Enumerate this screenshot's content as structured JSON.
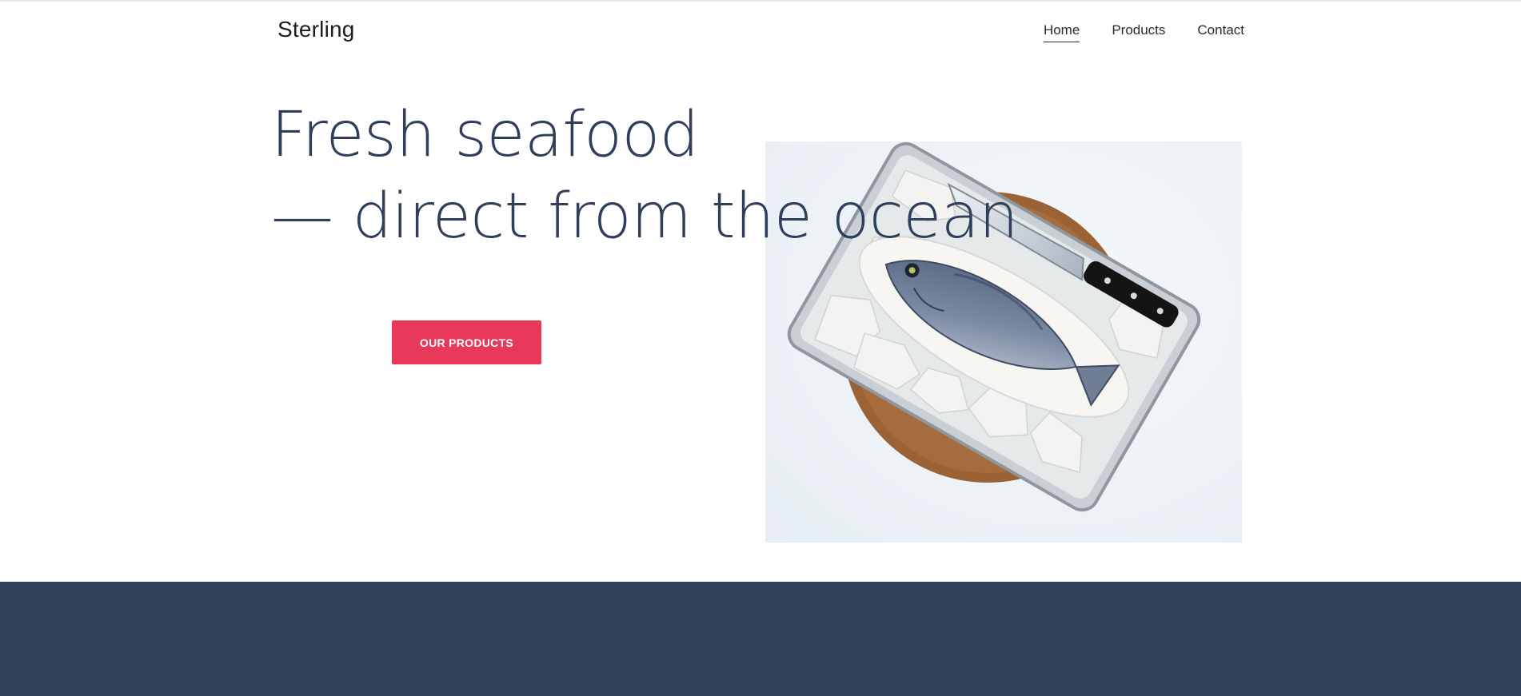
{
  "brand": {
    "name": "Sterling"
  },
  "nav": {
    "items": [
      {
        "label": "Home",
        "active": true
      },
      {
        "label": "Products",
        "active": false
      },
      {
        "label": "Contact",
        "active": false
      }
    ]
  },
  "hero": {
    "title_line1": "Fresh seafood",
    "title_line2": "— direct from the ocean",
    "cta_label": "OUR PRODUCTS",
    "image_subject": "fish-on-salt-tray-with-knife"
  },
  "colors": {
    "title": "#2e3e5b",
    "cta": "#e8395a",
    "footer_band": "#31425d"
  }
}
